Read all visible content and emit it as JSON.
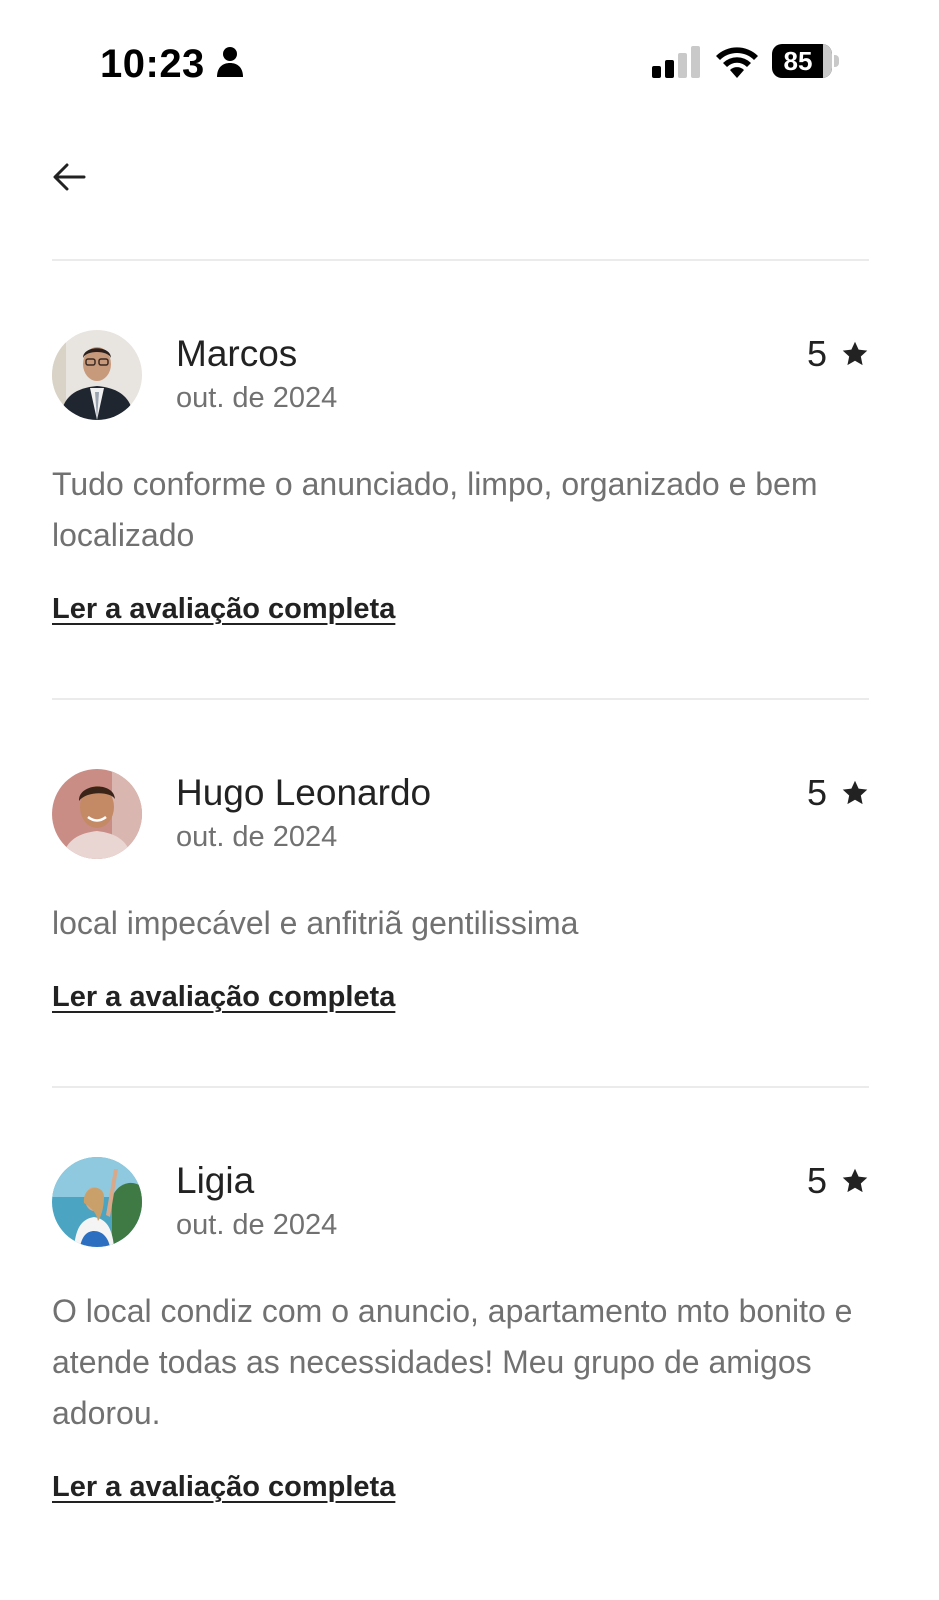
{
  "status_bar": {
    "time": "10:23",
    "battery_level": "85",
    "person_icon": "person-icon",
    "signal_icon": "cellular-signal-icon",
    "wifi_icon": "wifi-icon",
    "battery_icon": "battery-icon"
  },
  "nav": {
    "back_icon": "arrow-left-icon"
  },
  "colors": {
    "text_primary": "#222222",
    "text_secondary": "#717171",
    "divider": "#ebebeb"
  },
  "reviews": [
    {
      "name": "Marcos",
      "date": "out. de 2024",
      "rating": "5",
      "text": "Tudo conforme o anunciado, limpo, organizado e bem localizado",
      "read_more": "Ler a avaliação completa"
    },
    {
      "name": "Hugo Leonardo",
      "date": "out. de 2024",
      "rating": "5",
      "text": "local impecável e anfitriã gentilissima",
      "read_more": "Ler a avaliação completa"
    },
    {
      "name": "Ligia",
      "date": "out. de 2024",
      "rating": "5",
      "text": "O local condiz com o anuncio, apartamento mto bonito e atende todas as necessidades! Meu grupo de amigos adorou.",
      "read_more": "Ler a avaliação completa"
    }
  ]
}
